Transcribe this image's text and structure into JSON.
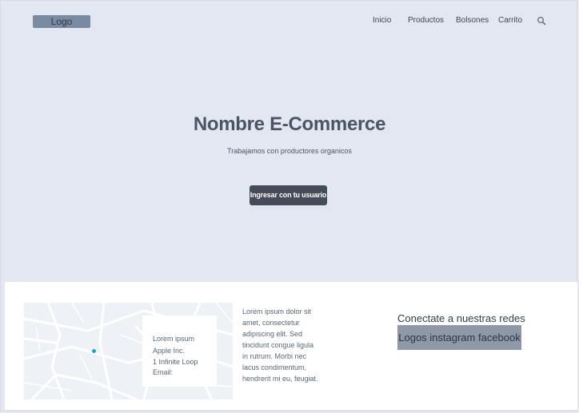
{
  "header": {
    "logo_label": "Logo",
    "nav": [
      {
        "label": "Inicio"
      },
      {
        "label": "Productos"
      },
      {
        "label": "Bolsones"
      },
      {
        "label": "Carrito"
      }
    ],
    "search_icon": "search-icon"
  },
  "hero": {
    "title": "Nombre E-Commerce",
    "subtitle": "Trabajamos con productores organicos",
    "cta_label": "Ingresar con tu usuario"
  },
  "footer": {
    "map_card": {
      "line1": "Lorem ipsum",
      "line2": "Apple Inc.",
      "line3": "1 Infinite Loop",
      "line4": "Email:"
    },
    "lorem_text": "Lorem ipsum dolor sit amet, consectetur adipiscing elit. Sed tincidunt congue ligula in rutrum. Morbi nec lacus condimentum, hendrerit mi eu, feugiat.",
    "social_title": "Conectate a nuestras redes",
    "social_logos": "Logos instagram facebook"
  },
  "colors": {
    "hero_bg": "#e3e7f1",
    "button_bg": "#434c58",
    "logo_bg": "#7a8aa2",
    "social_box_bg": "#8e98a6",
    "map_pin": "#1aa0e6"
  }
}
